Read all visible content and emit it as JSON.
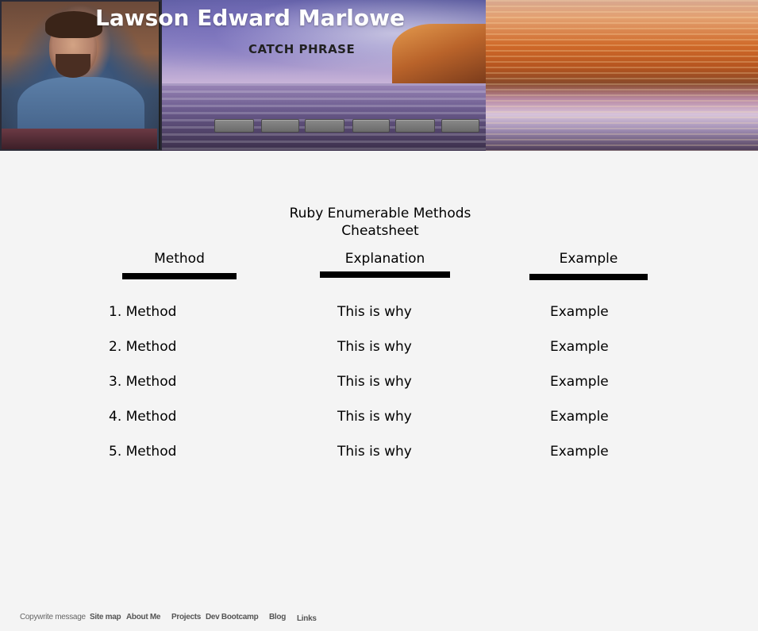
{
  "header": {
    "name": "Lawson Edward Marlowe",
    "catch_phrase": "CATCH PHRASE",
    "nav_buttons": [
      "",
      "",
      "",
      "",
      "",
      ""
    ]
  },
  "main": {
    "title_line1": "Ruby Enumerable Methods",
    "title_line2": "Cheatsheet",
    "columns": [
      "Method",
      "Explanation",
      "Example"
    ],
    "rows": [
      {
        "method": "1. Method",
        "explanation": "This is why",
        "example": "Example"
      },
      {
        "method": "2. Method",
        "explanation": "This is why",
        "example": "Example"
      },
      {
        "method": "3. Method",
        "explanation": "This is why",
        "example": "Example"
      },
      {
        "method": "4. Method",
        "explanation": "This is why",
        "example": "Example"
      },
      {
        "method": "5. Method",
        "explanation": "This is why",
        "example": "Example"
      }
    ]
  },
  "footer": {
    "copyright": "Copywrite message",
    "links": [
      "Site map",
      "About Me",
      "Projects",
      "Dev Bootcamp",
      "Blog",
      "Links"
    ]
  },
  "colors": {
    "page_background": "#f4f4f4",
    "header_title": "#ffffff",
    "underline": "#000000"
  }
}
